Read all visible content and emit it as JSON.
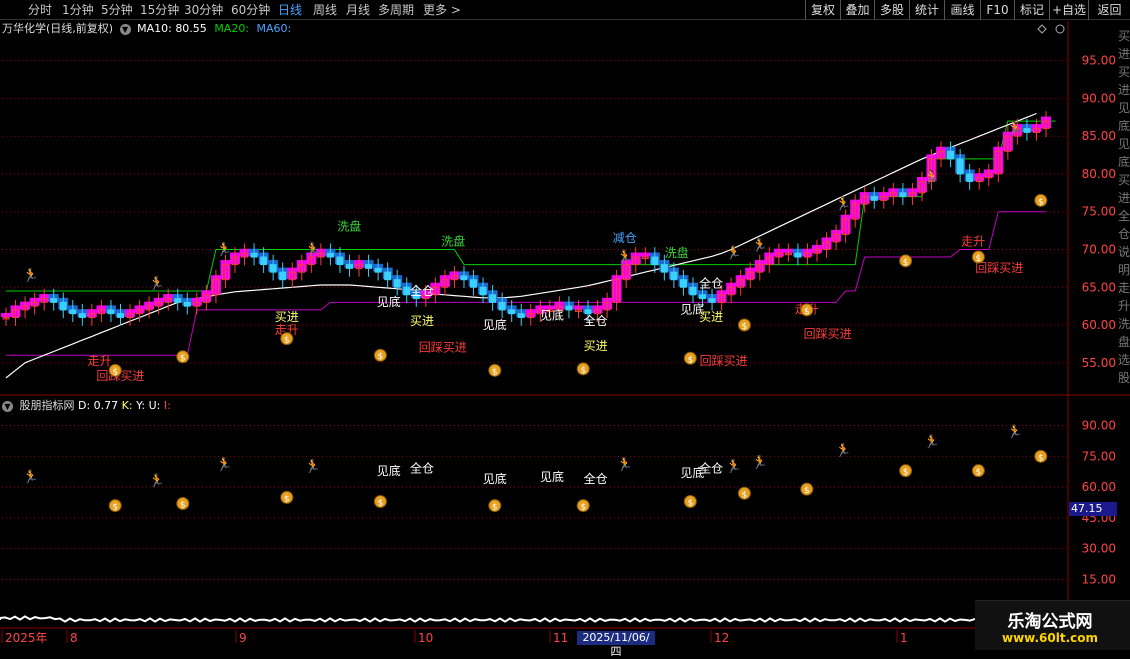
{
  "toolbar": {
    "periods": [
      "分时",
      "1分钟",
      "5分钟",
      "15分钟",
      "30分钟",
      "60分钟",
      "日线",
      "周线",
      "月线",
      "多周期",
      "更多 >"
    ],
    "active": "日线",
    "right_buttons": [
      "复权",
      "叠加",
      "多股",
      "统计",
      "画线",
      "F10",
      "标记",
      "+自选",
      "返回"
    ]
  },
  "main_header": {
    "stock": "万华化学(日线,前复权)",
    "ma10_label": "MA10:",
    "ma10_value": "80.55",
    "ma20_label": "MA20:",
    "ma60_label": "MA60:"
  },
  "sub_header": {
    "name": "股朋指标网",
    "d_label": "D: 0.77",
    "k_label": "K:",
    "y_label": "Y:",
    "u_label": "U:",
    "i_label": "I:"
  },
  "right_side_text": "买进买进见底见底买进全仓说明走升洗盘选股",
  "price_marker": "47.15",
  "date_marker": "2025/11/06/四",
  "watermark": {
    "name": "乐淘公式网",
    "url": "www.60lt.com"
  },
  "colors": {
    "up": "#ff3b3b",
    "down": "#3ad0ff",
    "band_up": "#ff00ff",
    "band_down": "#1e6fd8",
    "ma_white": "#ffffff",
    "ma_magenta": "#c000c0",
    "ma_green": "#00d000",
    "grid": "#8b0000"
  },
  "chart_data": {
    "type": "candlestick",
    "main_y_ticks": [
      95.0,
      90.0,
      85.0,
      80.0,
      75.0,
      70.0,
      65.0,
      60.0,
      55.0
    ],
    "main_ylim": [
      51,
      98
    ],
    "sub_y_ticks": [
      90.0,
      75.0,
      60.0,
      45.0,
      30.0,
      15.0
    ],
    "sub_ylim": [
      5,
      100
    ],
    "x_labels": [
      "2025年",
      "8",
      "9",
      "10",
      "11",
      "12",
      "1"
    ],
    "close": [
      61,
      62,
      62.5,
      63,
      63.5,
      63,
      62,
      61.5,
      61,
      61.5,
      62,
      61.5,
      61,
      61.5,
      62,
      62.5,
      63,
      63.5,
      63,
      62.5,
      63,
      64,
      66,
      68,
      69,
      69.5,
      69,
      68,
      67,
      66,
      67,
      68,
      69,
      69.5,
      69,
      68,
      67.5,
      68,
      67.5,
      67,
      66,
      65,
      64,
      63.5,
      64,
      65,
      66,
      66.5,
      66,
      65,
      64,
      63,
      62,
      61.5,
      61,
      61.5,
      62,
      62,
      62.5,
      62,
      62,
      61.5,
      62,
      63,
      66,
      68,
      69,
      69,
      68,
      67,
      66,
      65,
      64,
      63.5,
      63,
      64,
      65,
      66,
      67,
      68,
      69,
      69.5,
      69.5,
      69,
      69.5,
      70,
      71,
      72,
      74,
      76,
      77,
      76.5,
      77,
      77.5,
      77,
      77.5,
      79,
      82,
      83,
      82,
      80,
      79,
      79.5,
      80,
      83,
      85,
      86,
      85.5,
      86,
      87
    ],
    "ma60": [
      53,
      54,
      55,
      55.5,
      56,
      56.5,
      57,
      57.5,
      58,
      58.5,
      59,
      59.5,
      60,
      60.5,
      61,
      61.5,
      62,
      62.5,
      63,
      63.3,
      63.5,
      63.7,
      64,
      64.2,
      64.4,
      64.5,
      64.6,
      64.7,
      64.8,
      64.9,
      65,
      65.1,
      65.2,
      65.3,
      65.3,
      65.3,
      65.3,
      65.2,
      65.1,
      65,
      64.9,
      64.8,
      64.7,
      64.5,
      64.3,
      64.1,
      64,
      63.9,
      63.8,
      63.7,
      63.6,
      63.6,
      63.6,
      63.7,
      63.8,
      64,
      64.2,
      64.4,
      64.6,
      64.8,
      65,
      65.2,
      65.5,
      65.8,
      66.1,
      66.4,
      66.7,
      67,
      67.3,
      67.6,
      67.9,
      68.2,
      68.5,
      68.8,
      69.1,
      69.5,
      70,
      70.6,
      71.2,
      71.8,
      72.4,
      73,
      73.6,
      74.2,
      74.8,
      75.4,
      76,
      76.6,
      77.2,
      77.8,
      78.4,
      79,
      79.6,
      80.2,
      80.8,
      81.4,
      82,
      82.5,
      83,
      83.5,
      84,
      84.5,
      85,
      85.5,
      86,
      86.5,
      87,
      87.5,
      88
    ],
    "ma_magenta_line": [
      56,
      56,
      56,
      56,
      56,
      56,
      56,
      56,
      56,
      56,
      56,
      56,
      56,
      56,
      56,
      56,
      56,
      56,
      56,
      56,
      62,
      62,
      62,
      62,
      62,
      62,
      62,
      62,
      62,
      62,
      62,
      62,
      62,
      62,
      63,
      63,
      63,
      63,
      63,
      63,
      63,
      63,
      63,
      63,
      63,
      63,
      63,
      63,
      63,
      63,
      63,
      63,
      63,
      63,
      63,
      63,
      63,
      63,
      63,
      63,
      63,
      63,
      63,
      63,
      63,
      63,
      63,
      63,
      63,
      63,
      63,
      63,
      63,
      63,
      63,
      63,
      63,
      63,
      63,
      63,
      63,
      63,
      63,
      63,
      63,
      63,
      63,
      63,
      64.5,
      64.5,
      69,
      69,
      69,
      69,
      69,
      69,
      69,
      69,
      69,
      69,
      70,
      70,
      70,
      70,
      75,
      75,
      75,
      75,
      75,
      75
    ],
    "wash_line": [
      64.5,
      64.5,
      64.5,
      64.5,
      64.5,
      64.5,
      64.5,
      64.5,
      64.5,
      64.5,
      64.5,
      64.5,
      64.5,
      64.5,
      64.5,
      64.5,
      64.5,
      64.5,
      64.5,
      64.5,
      64.5,
      64.5,
      70,
      70,
      70,
      70,
      70,
      70,
      70,
      70,
      70,
      70,
      70,
      70,
      70,
      70,
      70,
      70,
      70,
      70,
      70,
      70,
      70,
      70,
      70,
      70,
      70,
      70,
      68,
      68,
      68,
      68,
      68,
      68,
      68,
      68,
      68,
      68,
      68,
      68,
      68,
      68,
      68,
      68,
      68,
      68,
      68,
      68,
      68,
      68,
      68,
      68,
      68,
      68,
      68,
      68,
      68,
      68,
      68,
      68,
      68,
      68,
      68,
      68,
      68,
      68,
      68,
      68,
      68,
      68,
      77,
      77,
      77,
      77,
      77,
      77,
      77,
      82,
      82,
      82,
      82,
      82,
      82,
      82,
      82,
      87,
      87,
      87,
      87,
      87,
      87
    ],
    "main_labels": [
      {
        "t": "洗盘",
        "x": 0.33,
        "v": 72.5,
        "c": "#3ad33a"
      },
      {
        "t": "洗盘",
        "x": 0.43,
        "v": 70.5,
        "c": "#3ad33a"
      },
      {
        "t": "减仓",
        "x": 0.595,
        "v": 71,
        "c": "#4aa3ff"
      },
      {
        "t": "洗盘",
        "x": 0.645,
        "v": 69,
        "c": "#3ad33a"
      },
      {
        "t": "买进",
        "x": 0.27,
        "v": 60.5,
        "c": "#ffff66"
      },
      {
        "t": "走升",
        "x": 0.27,
        "v": 58.8,
        "c": "#ff3b3b"
      },
      {
        "t": "见底",
        "x": 0.368,
        "v": 62.5,
        "c": "#ffffff"
      },
      {
        "t": "全仓",
        "x": 0.4,
        "v": 64,
        "c": "#ffffff"
      },
      {
        "t": "买进",
        "x": 0.4,
        "v": 60,
        "c": "#ffff66"
      },
      {
        "t": "回踩买进",
        "x": 0.42,
        "v": 56.5,
        "c": "#ff3b3b"
      },
      {
        "t": "见底",
        "x": 0.47,
        "v": 59.5,
        "c": "#ffffff"
      },
      {
        "t": "见底",
        "x": 0.525,
        "v": 60.7,
        "c": "#ffffff"
      },
      {
        "t": "全仓",
        "x": 0.567,
        "v": 60,
        "c": "#ffffff"
      },
      {
        "t": "买进",
        "x": 0.567,
        "v": 56.7,
        "c": "#ffff66"
      },
      {
        "t": "见底",
        "x": 0.66,
        "v": 61.5,
        "c": "#ffffff"
      },
      {
        "t": "全仓",
        "x": 0.678,
        "v": 65,
        "c": "#ffffff"
      },
      {
        "t": "买进",
        "x": 0.678,
        "v": 60.5,
        "c": "#ffff66"
      },
      {
        "t": "回踩买进",
        "x": 0.69,
        "v": 54.7,
        "c": "#ff3b3b"
      },
      {
        "t": "走升",
        "x": 0.77,
        "v": 61.5,
        "c": "#ff3b3b"
      },
      {
        "t": "回踩买进",
        "x": 0.79,
        "v": 58.3,
        "c": "#ff3b3b"
      },
      {
        "t": "走升",
        "x": 0.09,
        "v": 54.7,
        "c": "#ff3b3b"
      },
      {
        "t": "回踩买进",
        "x": 0.11,
        "v": 52.7,
        "c": "#ff3b3b"
      },
      {
        "t": "走升",
        "x": 0.93,
        "v": 70.5,
        "c": "#ff3b3b"
      },
      {
        "t": "回踩买进",
        "x": 0.955,
        "v": 67,
        "c": "#ff3b3b"
      }
    ],
    "sub_labels": [
      {
        "t": "见底",
        "x": 0.368,
        "v": 66
      },
      {
        "t": "全仓",
        "x": 0.4,
        "v": 67
      },
      {
        "t": "见底",
        "x": 0.47,
        "v": 62
      },
      {
        "t": "见底",
        "x": 0.525,
        "v": 63
      },
      {
        "t": "全仓",
        "x": 0.567,
        "v": 62
      },
      {
        "t": "见底",
        "x": 0.66,
        "v": 65
      },
      {
        "t": "全仓",
        "x": 0.678,
        "v": 67
      }
    ]
  }
}
